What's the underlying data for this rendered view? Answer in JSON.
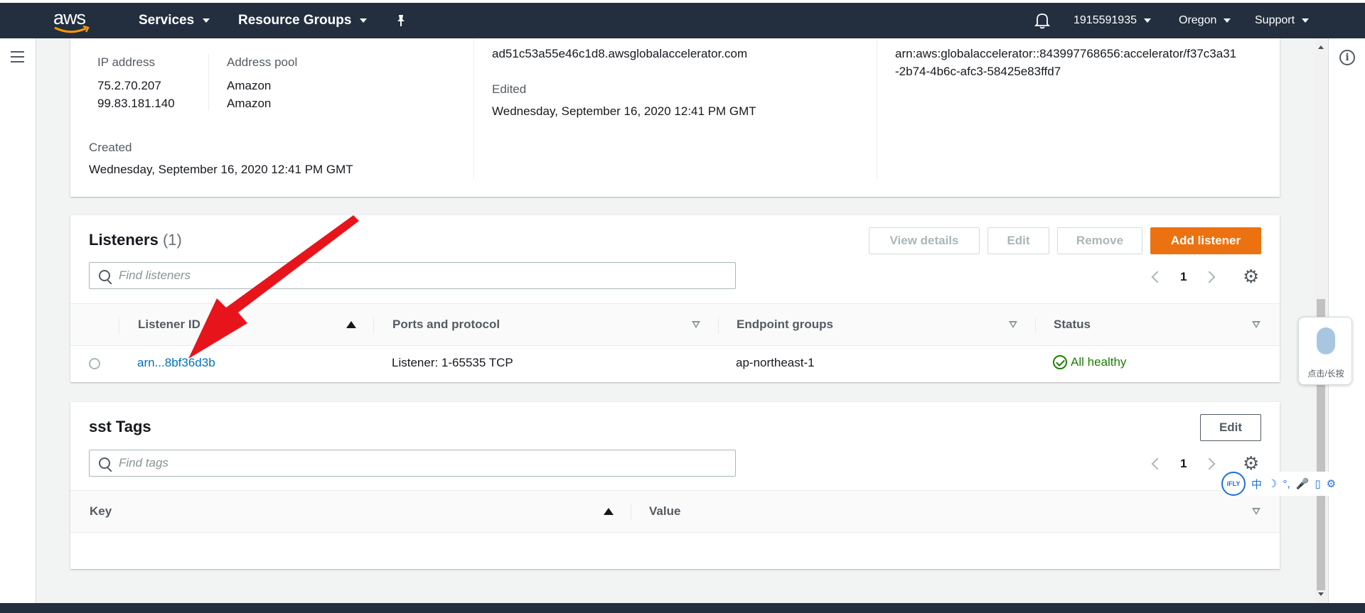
{
  "nav": {
    "logo_text": "aws",
    "services": "Services",
    "resource_groups": "Resource Groups",
    "account": "1915591935",
    "region": "Oregon",
    "support": "Support"
  },
  "details": {
    "ip_label": "IP address",
    "ip_values": [
      "75.2.70.207",
      "99.83.181.140"
    ],
    "pool_label": "Address pool",
    "pool_values": [
      "Amazon",
      "Amazon"
    ],
    "created_label": "Created",
    "created_value": "Wednesday, September 16, 2020 12:41 PM GMT",
    "dns_value": "ad51c53a55e46c1d8.awsglobalaccelerator.com",
    "edited_label": "Edited",
    "edited_value": "Wednesday, September 16, 2020 12:41 PM GMT",
    "arn_line1": "arn:aws:globalaccelerator::843997768656:accelerator/f37c3a31",
    "arn_line2": "-2b74-4b6c-afc3-58425e83ffd7"
  },
  "listeners": {
    "title": "Listeners",
    "count": "(1)",
    "buttons": {
      "view_details": "View details",
      "edit": "Edit",
      "remove": "Remove",
      "add": "Add listener"
    },
    "search_placeholder": "Find listeners",
    "page": "1",
    "columns": [
      "Listener ID",
      "Ports and protocol",
      "Endpoint groups",
      "Status"
    ],
    "rows": [
      {
        "id": "arn...8bf36d3b",
        "ports": "Listener: 1-65535 TCP",
        "endpoint": "ap-northeast-1",
        "status": "All healthy"
      }
    ]
  },
  "tags": {
    "title": "sst Tags",
    "edit": "Edit",
    "search_placeholder": "Find tags",
    "page": "1",
    "columns": [
      "Key",
      "Value"
    ]
  },
  "ime": {
    "mic_label": "点击/长按",
    "logo": "iFLY",
    "items": [
      "中",
      "☽",
      "°,",
      "🎤",
      "▯",
      "⚙"
    ]
  },
  "colors": {
    "nav_bg": "#232f3e",
    "primary": "#ec7211",
    "link": "#0073bb",
    "success": "#1d8102",
    "annotation_arrow": "#e8141b"
  }
}
